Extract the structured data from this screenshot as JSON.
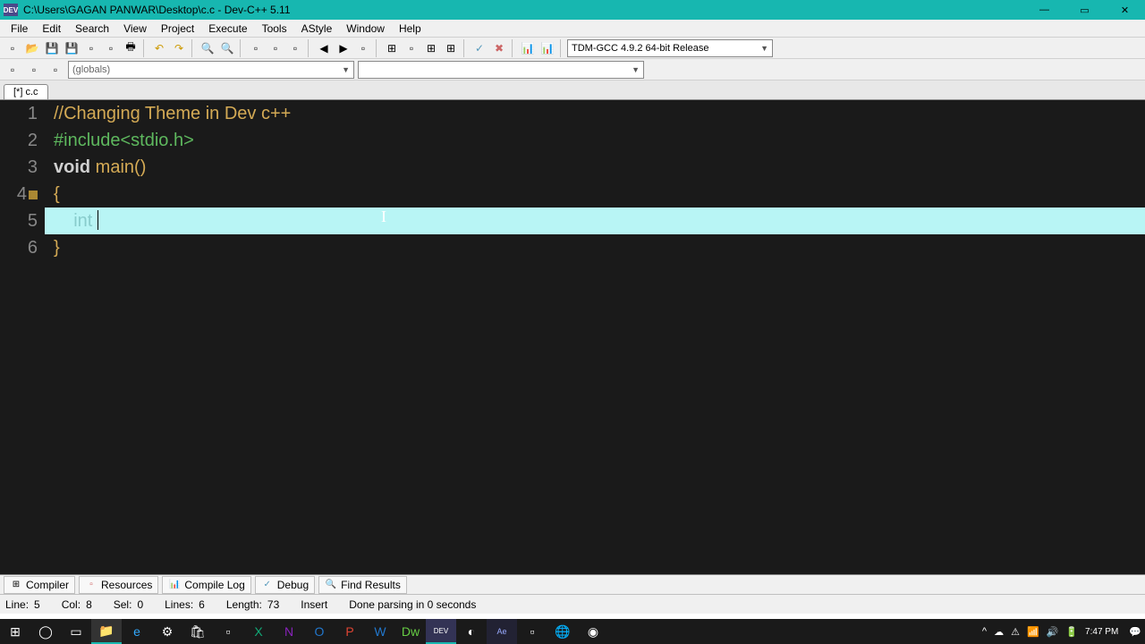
{
  "window": {
    "title": "C:\\Users\\GAGAN PANWAR\\Desktop\\c.c - Dev-C++ 5.11",
    "app_badge": "DEV"
  },
  "menu": {
    "file": "File",
    "edit": "Edit",
    "search": "Search",
    "view": "View",
    "project": "Project",
    "execute": "Execute",
    "tools": "Tools",
    "astyle": "AStyle",
    "window": "Window",
    "help": "Help"
  },
  "toolbar": {
    "compiler": "TDM-GCC 4.9.2 64-bit Release"
  },
  "scope": {
    "globals": "(globals)"
  },
  "tab": {
    "name": "[*] c.c"
  },
  "code": {
    "l1_comment": "//Changing Theme in Dev c++",
    "l2_preproc": "#include<stdio.h>",
    "l3_void": "void",
    "l3_main": " main()",
    "l4": "{",
    "l5_indent": "    ",
    "l5_int": "int ",
    "l6": "}"
  },
  "bottom_tabs": {
    "compiler": "Compiler",
    "resources": "Resources",
    "compile_log": "Compile Log",
    "debug": "Debug",
    "find_results": "Find Results"
  },
  "status": {
    "line_lbl": "Line:",
    "line_val": "5",
    "col_lbl": "Col:",
    "col_val": "8",
    "sel_lbl": "Sel:",
    "sel_val": "0",
    "lines_lbl": "Lines:",
    "lines_val": "6",
    "length_lbl": "Length:",
    "length_val": "73",
    "mode": "Insert",
    "parse": "Done parsing in 0 seconds"
  },
  "taskbar": {
    "time": "7:47 PM"
  }
}
